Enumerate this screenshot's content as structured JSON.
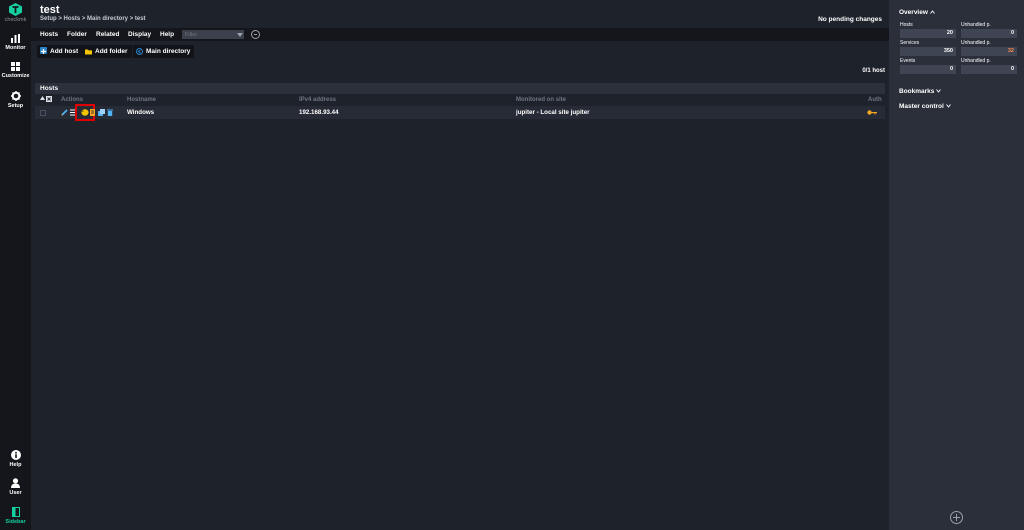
{
  "app": {
    "logo_text": "checkmk"
  },
  "nav": {
    "monitor": "Monitor",
    "customize": "Customize",
    "setup": "Setup",
    "help": "Help",
    "user": "User",
    "sidebar": "Sidebar"
  },
  "page": {
    "title": "test",
    "breadcrumb": "Setup > Hosts > Main directory > test",
    "pending": "No pending changes"
  },
  "menu": {
    "items": [
      "Hosts",
      "Folder",
      "Related",
      "Display",
      "Help"
    ],
    "filter_placeholder": "Filter"
  },
  "toolbar": {
    "add_host": "Add host",
    "add_folder": "Add folder",
    "main_directory": "Main directory"
  },
  "hosts": {
    "count": "0/1 host",
    "section_title": "Hosts",
    "columns": [
      "Actions",
      "Hostname",
      "IPv4 address",
      "Monitored on site",
      "Auth"
    ],
    "rows": [
      {
        "hostname": "Windows",
        "ipv4": "192.168.93.44",
        "site": "jupiter - Local site jupiter"
      }
    ]
  },
  "sidebar": {
    "overview_title": "Overview",
    "overview": {
      "hosts_label": "Hosts",
      "hosts_value": "20",
      "hosts_unhandled_label": "Unhandled p.",
      "hosts_unhandled_value": "0",
      "services_label": "Services",
      "services_value": "350",
      "services_unhandled_label": "Unhandled p.",
      "services_unhandled_value": "32",
      "events_label": "Events",
      "events_value": "0",
      "events_unhandled_label": "Unhandled p.",
      "events_unhandled_value": "0"
    },
    "bookmarks_title": "Bookmarks",
    "master_control_title": "Master control"
  },
  "colors": {
    "accent": "#15d1a0",
    "warning": "#ff8e4f",
    "highlight_box": "#e00000",
    "key_icon": "#f5a623"
  }
}
